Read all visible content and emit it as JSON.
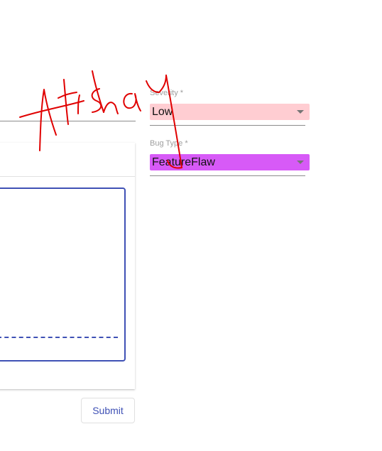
{
  "severity": {
    "label": "Severity *",
    "value": "Low",
    "color": "#ffcdd2"
  },
  "bug_type": {
    "label": "Bug Type *",
    "value": "FeatureFlaw",
    "color": "#d75af7"
  },
  "submit_label": "Submit",
  "accent_color": "#3f51b5",
  "annotation": {
    "text": "Atishay",
    "color": "#e00000"
  }
}
